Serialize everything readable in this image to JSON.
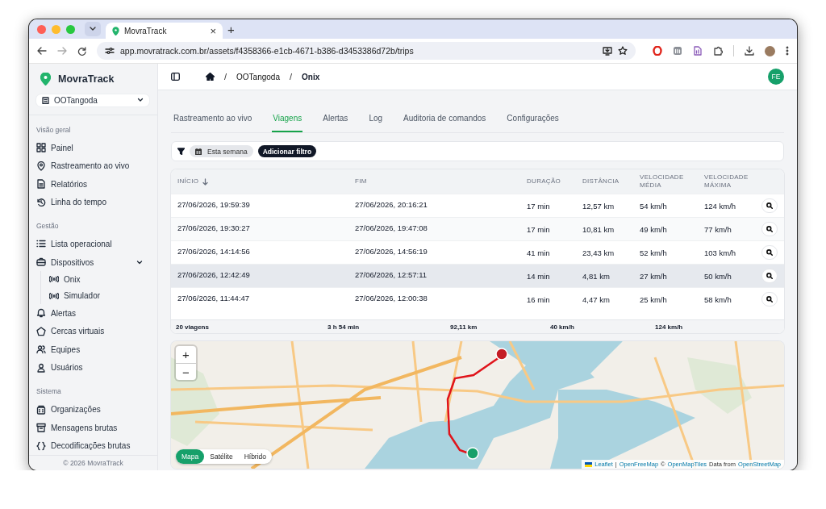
{
  "browser": {
    "tab_title": "MovraTrack",
    "tab_close": "×",
    "new_tab": "+",
    "url": "app.movratrack.com.br/assets/f4358366-e1cb-4671-b386-d3453386d72b/trips"
  },
  "sidebar": {
    "brand": "MovraTrack",
    "organization": "OOTangoda",
    "sections": [
      {
        "title": "Visão geral",
        "items": [
          {
            "label": "Painel"
          },
          {
            "label": "Rastreamento ao vivo"
          },
          {
            "label": "Relatórios"
          },
          {
            "label": "Linha do tempo"
          }
        ]
      },
      {
        "title": "Gestão",
        "items": [
          {
            "label": "Lista operacional"
          },
          {
            "label": "Dispositivos",
            "expanded": true,
            "children": [
              {
                "label": "Onix"
              },
              {
                "label": "Simulador"
              }
            ]
          },
          {
            "label": "Alertas"
          },
          {
            "label": "Cercas virtuais"
          },
          {
            "label": "Equipes"
          },
          {
            "label": "Usuários"
          }
        ]
      },
      {
        "title": "Sistema",
        "items": [
          {
            "label": "Organizações"
          },
          {
            "label": "Mensagens brutas"
          },
          {
            "label": "Decodificações brutas"
          }
        ]
      }
    ],
    "footer": "© 2026 MovraTrack"
  },
  "header": {
    "breadcrumbs": [
      {
        "separator": "/",
        "label": "OOTangoda",
        "current": false
      },
      {
        "separator": "/",
        "label": "Onix",
        "current": true
      }
    ],
    "avatar": "FE"
  },
  "tabs": [
    {
      "label": "Rastreamento ao vivo",
      "selected": false
    },
    {
      "label": "Viagens",
      "selected": true
    },
    {
      "label": "Alertas",
      "selected": false
    },
    {
      "label": "Log",
      "selected": false
    },
    {
      "label": "Auditoria de comandos",
      "selected": false
    },
    {
      "label": "Configurações",
      "selected": false
    }
  ],
  "filter": {
    "chip": "Esta semana",
    "add_button": "Adicionar filtro"
  },
  "table": {
    "columns": [
      {
        "label": "INÍCIO",
        "sorted": true
      },
      {
        "label": "FIM",
        "sorted": false
      },
      {
        "label": "DURAÇÃO",
        "sorted": false
      },
      {
        "label": "DISTÂNCIA",
        "sorted": false
      },
      {
        "label": "VELOCIDADE MÉDIA",
        "sorted": false
      },
      {
        "label": "VELOCIDADE MÁXIMA",
        "sorted": false
      }
    ],
    "rows": [
      {
        "cells": [
          "27/06/2026, 19:59:39",
          "27/06/2026, 20:16:21",
          "17 min",
          "12,57 km",
          "54 km/h",
          "124 km/h"
        ],
        "hovered": false
      },
      {
        "cells": [
          "27/06/2026, 19:30:27",
          "27/06/2026, 19:47:08",
          "17 min",
          "10,81 km",
          "49 km/h",
          "77 km/h"
        ],
        "hovered": false
      },
      {
        "cells": [
          "27/06/2026, 14:14:56",
          "27/06/2026, 14:56:19",
          "41 min",
          "23,43 km",
          "52 km/h",
          "103 km/h"
        ],
        "hovered": false
      },
      {
        "cells": [
          "27/06/2026, 12:42:49",
          "27/06/2026, 12:57:11",
          "14 min",
          "4,81 km",
          "27 km/h",
          "50 km/h"
        ],
        "hovered": true
      },
      {
        "cells": [
          "27/06/2026, 11:44:47",
          "27/06/2026, 12:00:38",
          "16 min",
          "4,47 km",
          "25 km/h",
          "58 km/h"
        ],
        "hovered": false
      }
    ],
    "totals": [
      "20 viagens",
      "3 h 54 min",
      "92,11 km",
      "40 km/h",
      "124 km/h"
    ]
  },
  "map": {
    "kind": "picture",
    "zoom_in": "+",
    "zoom_out": "−",
    "layers": [
      {
        "label": "Mapa",
        "selected": true
      },
      {
        "label": "Satélite",
        "selected": false
      },
      {
        "label": "Híbrido",
        "selected": false
      }
    ],
    "attribution": [
      {
        "kind": "link",
        "text": "Leaflet"
      },
      {
        "kind": "text",
        "text": "|"
      },
      {
        "kind": "link",
        "text": "OpenFreeMap"
      },
      {
        "kind": "text",
        "text": "©"
      },
      {
        "kind": "link",
        "text": "OpenMapTiles"
      },
      {
        "kind": "text",
        "text": "Data from"
      },
      {
        "kind": "link",
        "text": "OpenStreetMap"
      }
    ]
  }
}
